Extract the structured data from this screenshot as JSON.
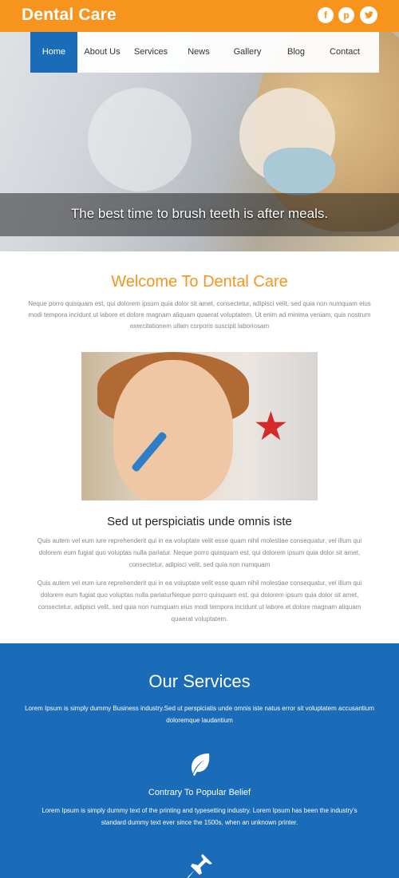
{
  "header": {
    "brand": "Dental Care",
    "social": [
      {
        "name": "facebook",
        "glyph": "f"
      },
      {
        "name": "pinterest",
        "glyph": "p"
      },
      {
        "name": "twitter",
        "glyph": "t"
      }
    ]
  },
  "nav": {
    "items": [
      "Home",
      "About Us",
      "Services",
      "News",
      "Gallery",
      "Blog",
      "Contact"
    ],
    "active": "Home"
  },
  "hero": {
    "caption": "The best time to brush teeth is after meals."
  },
  "welcome": {
    "title": "Welcome To Dental Care",
    "text": "Neque porro quisquam est, qui dolorem ipsum quia dolor sit amet, consectetur, adipisci velit, sed quia non numquam eius modi tempora incidunt ut labore et dolore magnam aliquam quaerat voluptatem. Ut enim ad minima veniam, quis nostrum exercitationem ullam corporis suscipit laboriosam"
  },
  "article": {
    "title": "Sed ut perspiciatis unde omnis iste",
    "para1": "Quis autem vel eum iure reprehenderit qui in ea voluptate velit esse quam nihil molestiae consequatur, vel illum qui dolorem eum fugiat quo voluptas nulla pariatur. Neque porro quisquam est, qui dolorem ipsum quia dolor sit amet, consectetur, adipisci velit, sed quia non numquam",
    "para2": "Quis autem vel eum iure reprehenderit qui in ea voluptate velit esse quam nihil molestiae consequatur, vel illum qui dolorem eum fugiat quo voluptas nulla pariaturNeque porro quisquam est, qui dolorem ipsum quia dolor sit amet, consectetur, adipisci velit, sed quia non numquam eius modi tempora incidunt ut labore et dolore magnam aliquam quaerat voluptatem."
  },
  "services": {
    "title": "Our Services",
    "intro": "Lorem Ipsum is simply dummy Business industry.Sed ut perspiciatis unde omnis iste natus error sit voluptatem accusantium doloremque laudantium",
    "items": [
      {
        "icon": "leaf-icon",
        "title": "Contrary To Popular Belief",
        "text": "Lorem Ipsum is simply dummy text of the printing and typesetting industry. Lorem Ipsum has been the industry's standard dummy text ever since the 1500s, when an unknown printer."
      },
      {
        "icon": "pushpin-icon"
      }
    ]
  },
  "colors": {
    "accent": "#f7941d",
    "primary": "#1a6bb8",
    "body_text": "#888888"
  }
}
